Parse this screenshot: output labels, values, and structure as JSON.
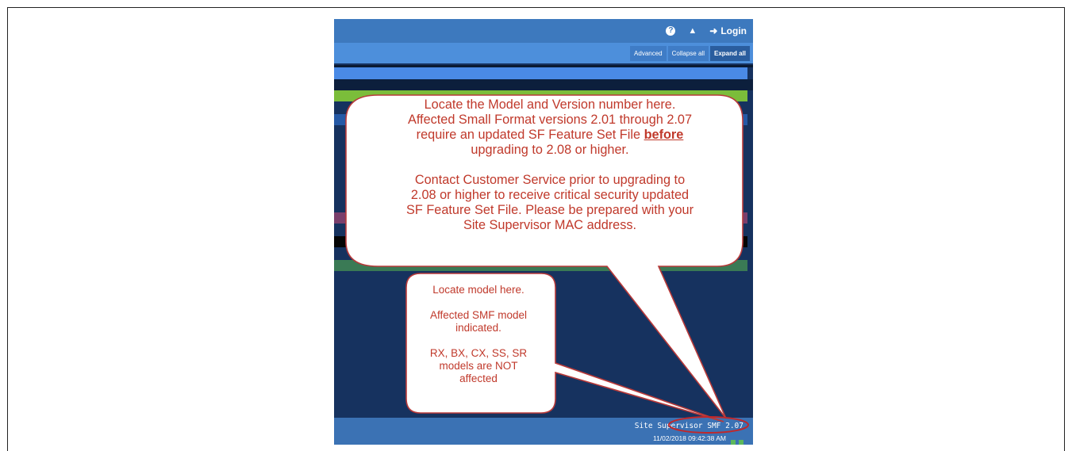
{
  "header": {
    "help_icon": "question-circle-icon",
    "bell_icon": "bell-icon",
    "login_label": "Login"
  },
  "toolbar": {
    "advanced_label": "Advanced",
    "collapse_label": "Collapse all",
    "expand_label": "Expand all"
  },
  "footer": {
    "model_version": "Site Supervisor SMF 2.07",
    "timestamp": "11/02/2018 09:42:38 AM"
  },
  "big_callout": {
    "line1": "Locate the Model and Version number here.",
    "line2": "Affected Small Format versions 2.01 through 2.07",
    "line3a": "require an updated SF Feature Set File ",
    "line3b": "before",
    "line4": "upgrading to 2.08 or higher.",
    "line5": "Contact  Customer Service prior to upgrading to",
    "line6": "2.08 or higher to receive critical security updated",
    "line7": "SF Feature Set File.  Please be prepared with your",
    "line8": "Site Supervisor MAC address."
  },
  "small_callout": {
    "line1": "Locate model here.",
    "line2": "Affected SMF model",
    "line3": "indicated.",
    "line4": "RX, BX, CX, SS, SR",
    "line5": "models are NOT",
    "line6": "affected"
  },
  "colors": {
    "callout_text": "#c0392b",
    "callout_stroke": "#b83a3a",
    "callout_fill": "#ffffff",
    "highlight_ellipse": "#c0282b"
  }
}
